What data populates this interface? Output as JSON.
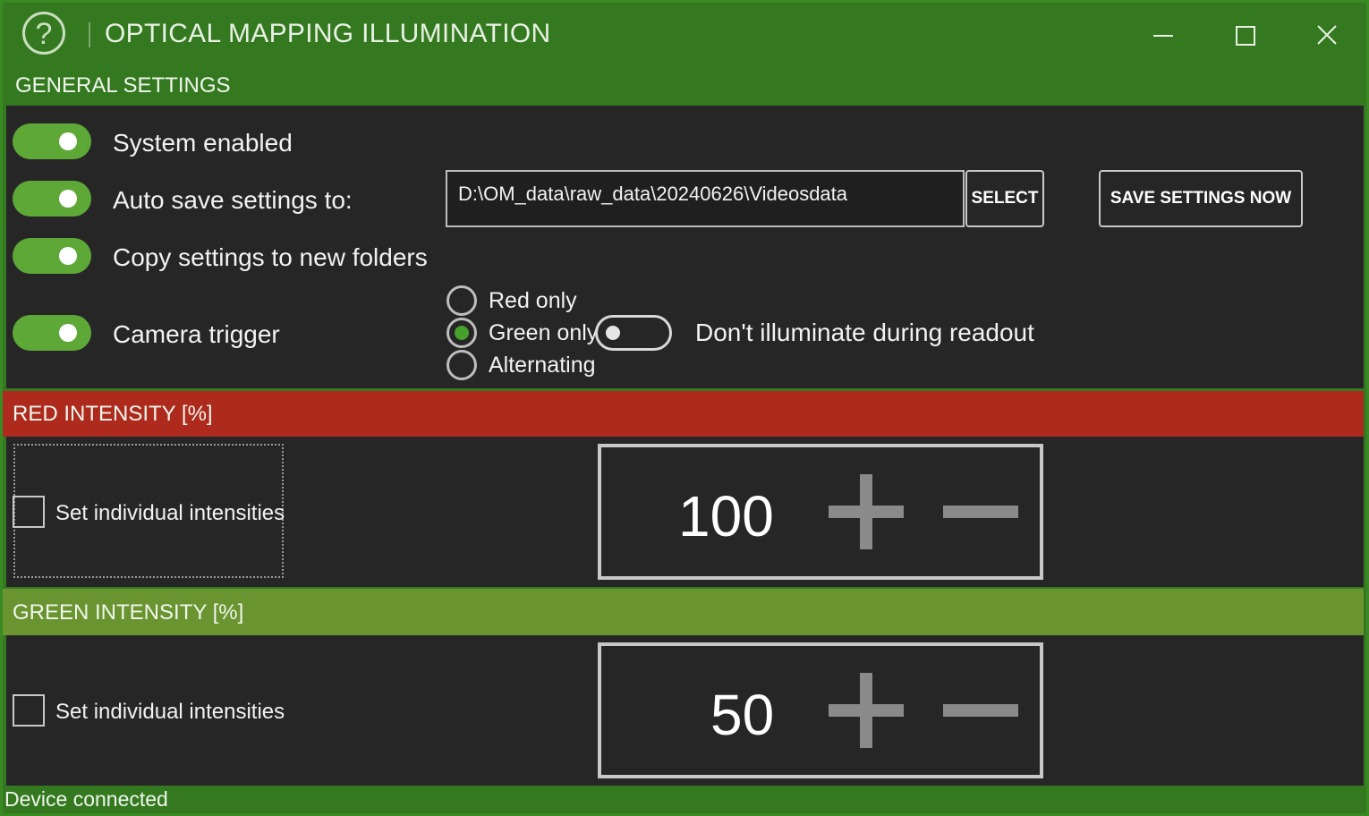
{
  "window": {
    "title": "OPTICAL MAPPING ILLUMINATION",
    "help_glyph": "?",
    "close_glyph": "✕"
  },
  "general": {
    "header": "GENERAL SETTINGS",
    "system_enabled": {
      "label": "System enabled",
      "on": true
    },
    "auto_save": {
      "label": "Auto save settings to:",
      "on": true,
      "path": "D:\\OM_data\\raw_data\\20240626\\Videosdata"
    },
    "select_button": "SELECT",
    "save_now_button": "SAVE SETTINGS NOW",
    "copy_settings": {
      "label": "Copy settings to new folders",
      "on": true
    },
    "camera_trigger": {
      "label": "Camera trigger",
      "on": true
    },
    "illumination_modes": [
      "Red only",
      "Green only",
      "Alternating"
    ],
    "selected_mode": "Green only",
    "no_illum_readout": {
      "label": "Don't illuminate during readout",
      "on": false
    }
  },
  "red": {
    "header": "RED INTENSITY [%]",
    "individual_label": "Set individual intensities",
    "individual_checked": false,
    "value": "100"
  },
  "green": {
    "header": "GREEN INTENSITY [%]",
    "individual_label": "Set individual intensities",
    "individual_checked": false,
    "value": "50"
  },
  "status": "Device connected",
  "colors": {
    "title_green": "#34791f",
    "toggle_green": "#5ea838",
    "red_header": "#ad2a1d",
    "green_header": "#69942f",
    "panel_bg": "#262626"
  }
}
